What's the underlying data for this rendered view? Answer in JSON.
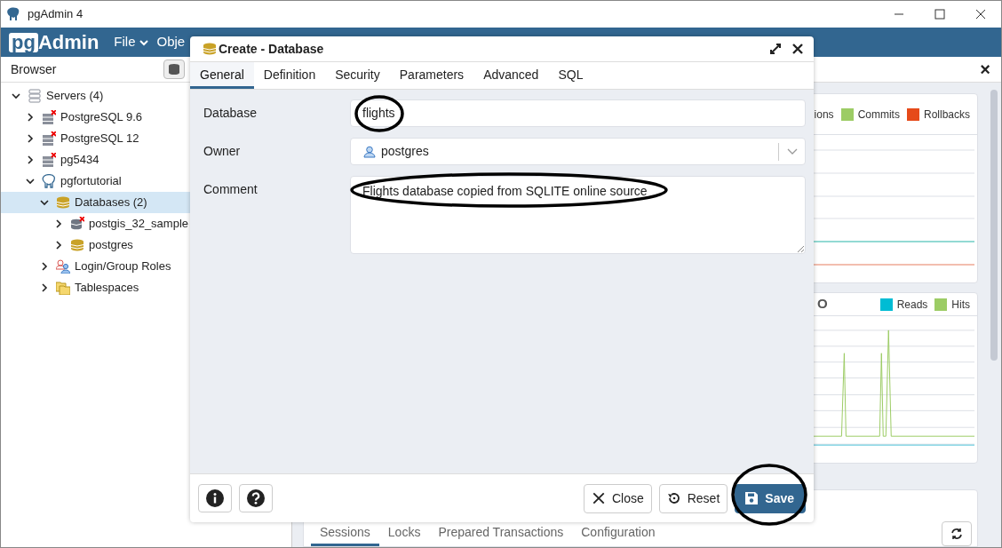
{
  "window": {
    "title": "pgAdmin 4"
  },
  "logo": {
    "prefix": "pg",
    "name": "Admin"
  },
  "menu": [
    {
      "label": "File",
      "caret": true
    },
    {
      "label": "Obje",
      "caret": false
    }
  ],
  "browser": {
    "title": "Browser",
    "tree": [
      {
        "label": "Servers (4)",
        "kind": "server-group",
        "expanded": true,
        "selected": false,
        "children": [
          {
            "label": "PostgreSQL 9.6",
            "kind": "server-error",
            "expanded": false,
            "selected": false
          },
          {
            "label": "PostgreSQL 12",
            "kind": "server-error",
            "expanded": false,
            "selected": false
          },
          {
            "label": "pg5434",
            "kind": "server-error",
            "expanded": false,
            "selected": false
          },
          {
            "label": "pgfortutorial",
            "kind": "elephant",
            "expanded": true,
            "selected": false,
            "children": [
              {
                "label": "Databases (2)",
                "kind": "databases",
                "expanded": true,
                "selected": true,
                "children": [
                  {
                    "label": "postgis_32_sample",
                    "kind": "database-error",
                    "expanded": false,
                    "selected": false
                  },
                  {
                    "label": "postgres",
                    "kind": "database",
                    "expanded": false,
                    "selected": false
                  }
                ]
              },
              {
                "label": "Login/Group Roles",
                "kind": "roles",
                "expanded": false,
                "selected": false
              },
              {
                "label": "Tablespaces",
                "kind": "tablespaces",
                "expanded": false,
                "selected": false
              }
            ]
          }
        ]
      }
    ]
  },
  "dashboard": {
    "close": "×",
    "activity_panel": {
      "legend": [
        {
          "label": "ions"
        },
        {
          "label": "Commits",
          "color": "#9ccc65"
        },
        {
          "label": "Rollbacks",
          "color": "#e64a19"
        }
      ]
    },
    "io_panel": {
      "title": "O",
      "legend": [
        {
          "label": "Reads",
          "color": "#00bcd4"
        },
        {
          "label": "Hits",
          "color": "#9ccc65"
        }
      ]
    },
    "bottom_tabs": [
      {
        "label": "Sessions",
        "selected": true
      },
      {
        "label": "Locks",
        "selected": false
      },
      {
        "label": "Prepared Transactions",
        "selected": false
      },
      {
        "label": "Configuration",
        "selected": false
      }
    ]
  },
  "dialog": {
    "title": "Create - Database",
    "tabs": [
      {
        "label": "General",
        "selected": true
      },
      {
        "label": "Definition",
        "selected": false
      },
      {
        "label": "Security",
        "selected": false
      },
      {
        "label": "Parameters",
        "selected": false
      },
      {
        "label": "Advanced",
        "selected": false
      },
      {
        "label": "SQL",
        "selected": false
      }
    ],
    "fields": [
      {
        "label": "Database",
        "kind": "text",
        "value": "flights"
      },
      {
        "label": "Owner",
        "kind": "select",
        "value": "postgres"
      },
      {
        "label": "Comment",
        "kind": "textarea",
        "value": "Flights database copied from SQLITE online source"
      }
    ],
    "buttons": [
      {
        "label": "Close",
        "kind": "close"
      },
      {
        "label": "Reset",
        "kind": "reset"
      },
      {
        "label": "Save",
        "kind": "save"
      }
    ]
  }
}
